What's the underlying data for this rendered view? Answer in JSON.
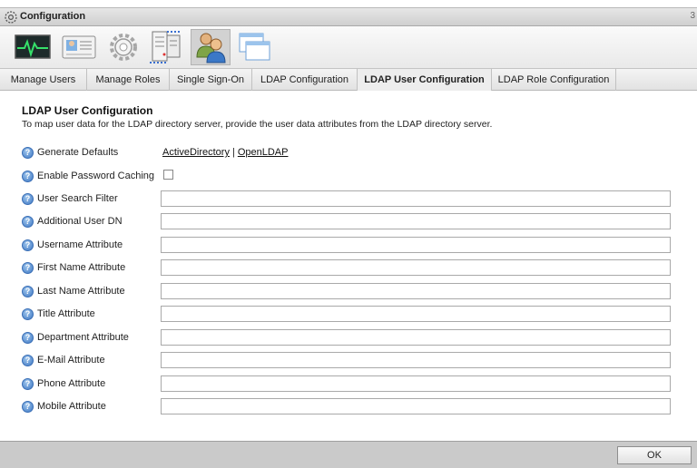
{
  "window": {
    "title": "Configuration",
    "close_label": "3"
  },
  "toolbar": {
    "tools": [
      "monitor-icon",
      "user-card-icon",
      "settings-gear-icon",
      "server-icon",
      "users-icon",
      "windows-icon"
    ],
    "active_tool": "users-icon"
  },
  "tabs": [
    {
      "label": "Manage Users"
    },
    {
      "label": "Manage Roles"
    },
    {
      "label": "Single Sign-On"
    },
    {
      "label": "LDAP Configuration"
    },
    {
      "label": "LDAP User Configuration",
      "active": true
    },
    {
      "label": "LDAP Role Configuration"
    }
  ],
  "content": {
    "heading": "LDAP User Configuration",
    "description": "To map user data for the LDAP directory server, provide the user data attributes from the LDAP directory server.",
    "generate_defaults": {
      "label": "Generate Defaults",
      "link_active_directory": "ActiveDirectory",
      "separator": "|",
      "link_open_ldap": "OpenLDAP"
    },
    "enable_password_caching": {
      "label": "Enable Password Caching",
      "checked": false
    },
    "fields": [
      {
        "label": "User Search Filter",
        "value": ""
      },
      {
        "label": "Additional User DN",
        "value": ""
      },
      {
        "label": "Username Attribute",
        "value": ""
      },
      {
        "label": "First Name Attribute",
        "value": ""
      },
      {
        "label": "Last Name Attribute",
        "value": ""
      },
      {
        "label": "Title Attribute",
        "value": ""
      },
      {
        "label": "Department Attribute",
        "value": ""
      },
      {
        "label": "E-Mail Attribute",
        "value": ""
      },
      {
        "label": "Phone Attribute",
        "value": ""
      },
      {
        "label": "Mobile Attribute",
        "value": ""
      }
    ]
  },
  "footer": {
    "ok_label": "OK"
  },
  "colors": {
    "help_icon": "#3f78c4",
    "footer_bg": "#cacaca"
  }
}
